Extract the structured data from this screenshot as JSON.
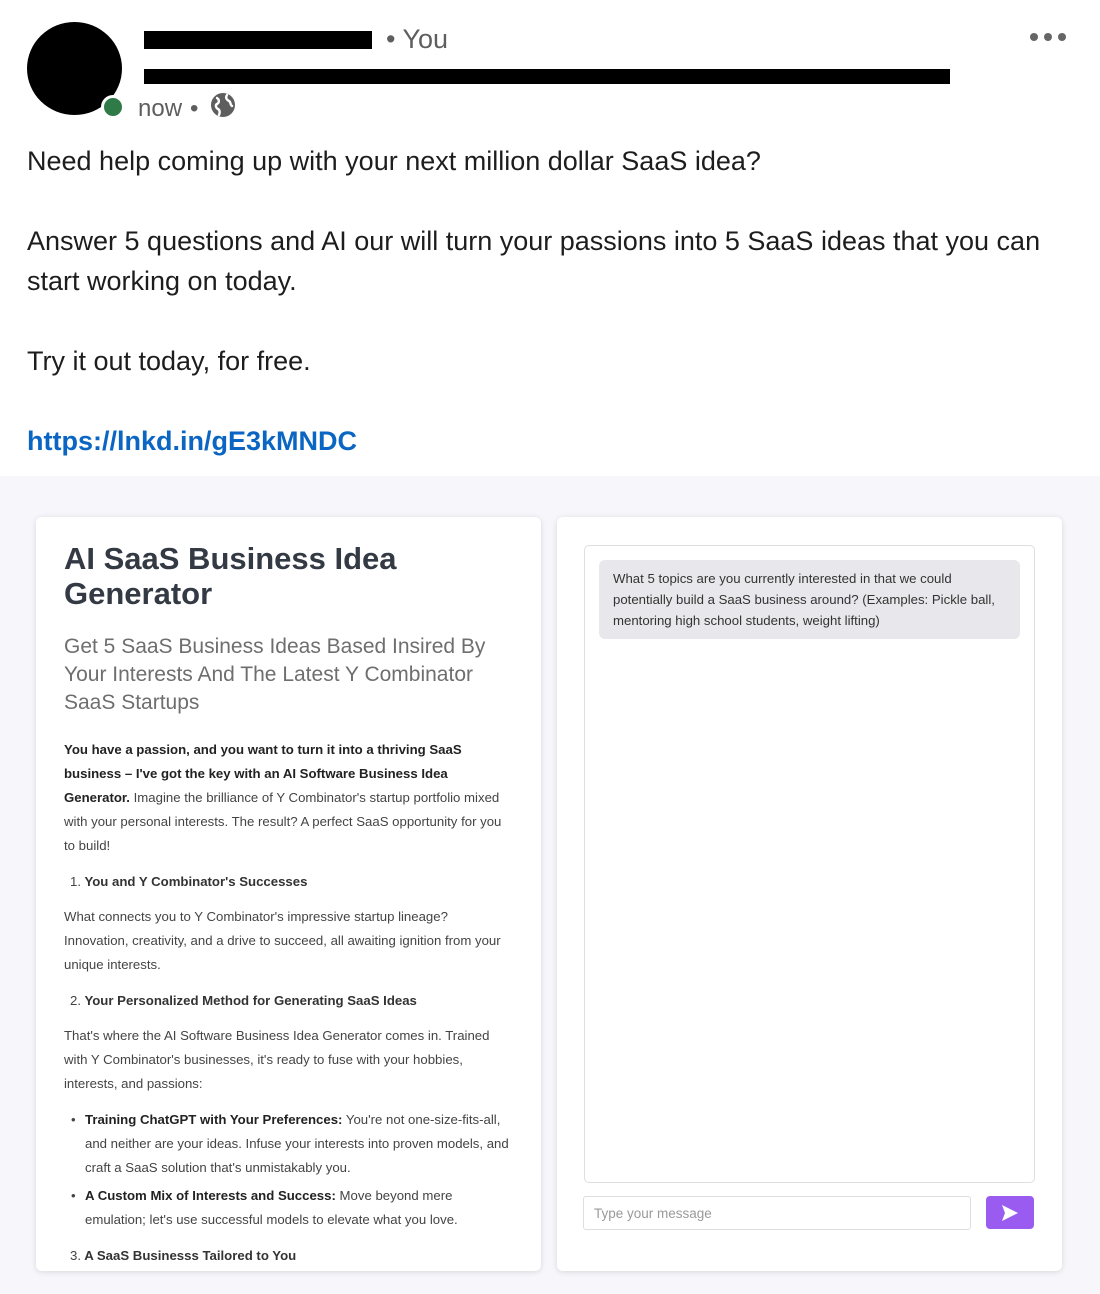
{
  "post": {
    "you_label": "• You",
    "time": "now",
    "time_separator": "•",
    "paragraphs": {
      "p1": "Need help coming up with your next million dollar SaaS idea?",
      "p2": "Answer 5 questions and AI our will turn your passions into 5 SaaS ideas that you can start working on today.",
      "p3": "Try it out today, for free."
    },
    "link": "https://lnkd.in/gE3kMNDC"
  },
  "preview": {
    "title": "AI SaaS Business Idea Generator",
    "subtitle": "Get 5 SaaS Business Ideas Based Insired By Your Interests And The Latest Y Combinator SaaS Startups",
    "intro_bold": "You have a passion, and you want to turn it into a thriving SaaS business – I've got the key with an AI Software Business Idea Generator.",
    "intro_rest": " Imagine the brilliance of Y Combinator's startup portfolio mixed with your personal interests. The result? A perfect SaaS opportunity for you to build!",
    "sections": [
      {
        "num": "1.",
        "heading": "You and Y Combinator's Successes",
        "text": "What connects you to Y Combinator's impressive startup lineage? Innovation, creativity, and a drive to succeed, all awaiting ignition from your unique interests."
      },
      {
        "num": "2.",
        "heading": "Your Personalized Method for Generating SaaS Ideas",
        "text": "That's where the AI Software Business Idea Generator comes in. Trained with Y Combinator's businesses, it's ready to fuse with your hobbies, interests, and passions:"
      },
      {
        "num": "3.",
        "heading": "A SaaS Businesss Tailored to You"
      }
    ],
    "bullets": [
      {
        "bold": "Training ChatGPT with Your Preferences:",
        "text": " You're not one-size-fits-all, and neither are your ideas. Infuse your interests into proven models, and craft a SaaS solution that's unmistakably you."
      },
      {
        "bold": "A Custom Mix of Interests and Success:",
        "text": " Move beyond mere emulation; let's use successful models to elevate what you love."
      }
    ]
  },
  "chat": {
    "bot_message": "What 5 topics are you currently interested in that we could potentially build a SaaS business around? (Examples: Pickle ball, mentoring high school students, weight lifting)",
    "input_placeholder": "Type your message",
    "input_value": ""
  },
  "colors": {
    "link": "#0a66c2",
    "online": "#2f7a47",
    "send_button": "#9a5cf0",
    "preview_bg": "#f7f6fb"
  },
  "icons": {
    "more": "more-horizontal-icon",
    "visibility": "globe-icon",
    "send": "send-icon"
  }
}
